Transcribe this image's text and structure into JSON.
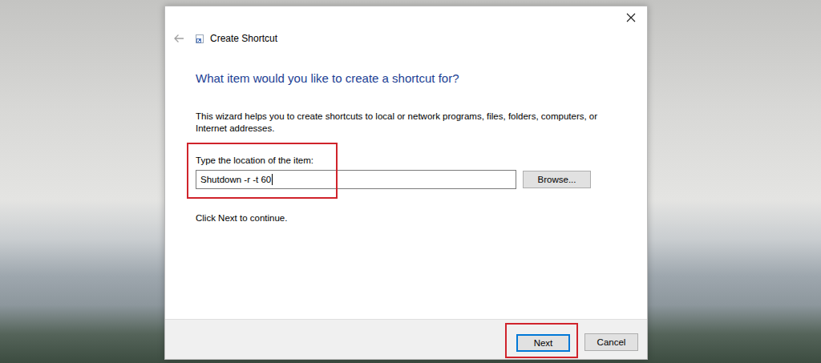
{
  "window": {
    "title": "Create Shortcut"
  },
  "back_button": {
    "disabled": true
  },
  "heading": "What item would you like to create a shortcut for?",
  "description": "This wizard helps you to create shortcuts to local or network programs, files, folders, computers, or Internet addresses.",
  "location": {
    "label": "Type the location of the item:",
    "value": "Shutdown -r -t 60",
    "focused": true,
    "annotated": true
  },
  "browse_button": "Browse...",
  "hint": "Click Next to continue.",
  "buttons": [
    {
      "label": "Next",
      "default": true,
      "annotated": true
    },
    {
      "label": "Cancel",
      "default": false,
      "annotated": false
    }
  ]
}
